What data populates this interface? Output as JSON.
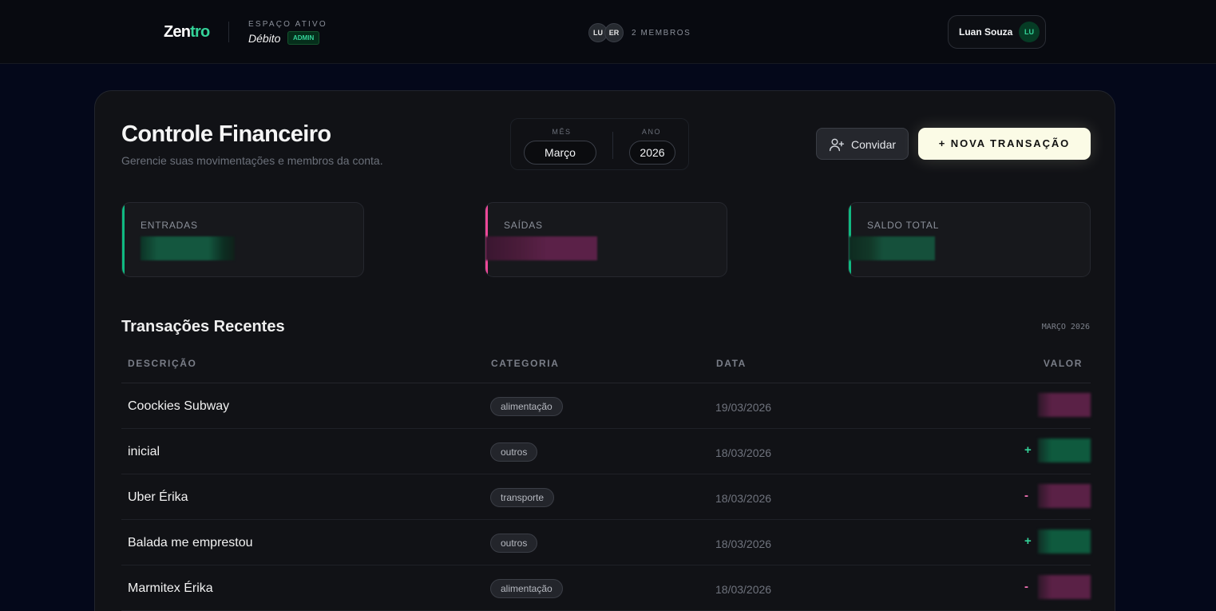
{
  "header": {
    "logo_main": "Zen",
    "logo_accent": "tro",
    "space_label": "ESPAÇO ATIVO",
    "space_name": "Débito",
    "role_badge": "ADMIN",
    "member_initials": [
      "LU",
      "ER"
    ],
    "members_label": "2 MEMBROS",
    "user_name": "Luan Souza",
    "user_initials": "LU"
  },
  "page": {
    "title": "Controle Financeiro",
    "subtitle": "Gerencie suas movimentações e membros da conta."
  },
  "period": {
    "month_label": "MÊS",
    "month_value": "Março",
    "year_label": "ANO",
    "year_value": "2026"
  },
  "actions": {
    "invite_label": "Convidar",
    "new_transaction_label": "+ NOVA TRANSAÇÃO"
  },
  "stats": [
    {
      "label": "ENTRADAS",
      "accent": "#10b981"
    },
    {
      "label": "SAÍDAS",
      "accent": "#ec4899"
    },
    {
      "label": "SALDO TOTAL",
      "accent": "#10b981"
    }
  ],
  "transactions": {
    "title": "Transações Recentes",
    "period_label": "MARÇO 2026",
    "columns": {
      "description": "DESCRIÇÃO",
      "category": "CATEGORIA",
      "date": "DATA",
      "value": "VALOR"
    },
    "rows": [
      {
        "description": "Coockies Subway",
        "category": "alimentação",
        "date": "19/03/2026",
        "sign": "",
        "type": "expense"
      },
      {
        "description": "inicial",
        "category": "outros",
        "date": "18/03/2026",
        "sign": "+",
        "type": "income"
      },
      {
        "description": "Uber Érika",
        "category": "transporte",
        "date": "18/03/2026",
        "sign": "-",
        "type": "expense"
      },
      {
        "description": "Balada me emprestou",
        "category": "outros",
        "date": "18/03/2026",
        "sign": "+",
        "type": "income"
      },
      {
        "description": "Marmitex Érika",
        "category": "alimentação",
        "date": "18/03/2026",
        "sign": "-",
        "type": "expense"
      }
    ]
  },
  "colors": {
    "income": "#34d399",
    "expense": "#f472b6",
    "income_blur": "#0f5a3e",
    "expense_blur": "#5a2146"
  }
}
